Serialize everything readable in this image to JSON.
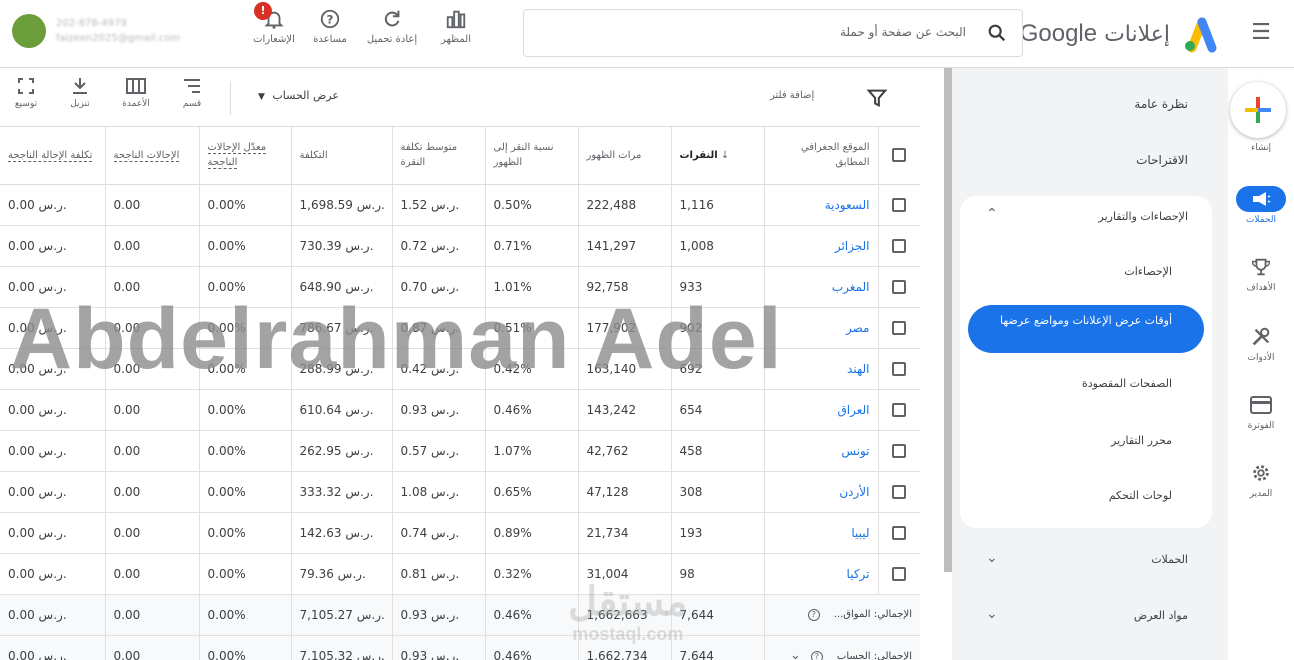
{
  "header": {
    "brand_ar": "إعلانات",
    "brand_google": "Google",
    "search_placeholder": "البحث عن صفحة أو حملة",
    "tools": {
      "appearance": "المظهر",
      "reload": "إعادة تحميل",
      "help": "مساعدة",
      "notifications": "الإشعارات"
    },
    "notifications_badge": "!",
    "account_phone": "202-878-4979",
    "account_email": "faizeen2025@gmail.com"
  },
  "rail": {
    "create": "إنشاء",
    "campaigns": "الحملات",
    "goals": "الأهداف",
    "tools": "الأدوات",
    "billing": "الفوترة",
    "admin": "المدير"
  },
  "nav": {
    "overview": "نظرة عامة",
    "recommendations": "الاقتراحات",
    "insights_reports": "الإحصاءات والتقارير",
    "insights": "الإحصاءات",
    "when_where": "أوقات عرض الإعلانات ومواضع عرضها",
    "landing_pages": "الصفحات المقصودة",
    "report_editor": "محرر التقارير",
    "dashboards": "لوحات التحكم",
    "campaigns": "الحملات",
    "assets": "مواد العرض"
  },
  "toolbar": {
    "add_filter": "إضافة فلتر",
    "view": "عرض الحساب",
    "segment": "قسم",
    "columns": "الأعمدة",
    "download": "تنزيل",
    "expand": "توسيع"
  },
  "table": {
    "headers": {
      "geo": "الموقع الجغرافي المطابق",
      "clicks": "النقرات",
      "impressions": "مرات الظهور",
      "ctr": "نسبة النقر إلى الظهور",
      "avg_cpc": "متوسط تكلفة النقرة",
      "cost": "التكلفة",
      "conv_rate": "معدّل الإحالات الناجحة",
      "conversions": "الإحالات الناجحة",
      "cost_per_conv": "تكلفة الإحالة الناجحة"
    },
    "rows": [
      {
        "geo": "السعودية",
        "clicks": "1,116",
        "impr": "222,488",
        "ctr": "0.50%",
        "cpc": "1.52 ر.س.",
        "cost": "1,698.59 ر.س.",
        "cr": "0.00%",
        "conv": "0.00",
        "cpa": "0.00 ر.س."
      },
      {
        "geo": "الجزائر",
        "clicks": "1,008",
        "impr": "141,297",
        "ctr": "0.71%",
        "cpc": "0.72 ر.س.",
        "cost": "730.39 ر.س.",
        "cr": "0.00%",
        "conv": "0.00",
        "cpa": "0.00 ر.س."
      },
      {
        "geo": "المغرب",
        "clicks": "933",
        "impr": "92,758",
        "ctr": "1.01%",
        "cpc": "0.70 ر.س.",
        "cost": "648.90 ر.س.",
        "cr": "0.00%",
        "conv": "0.00",
        "cpa": "0.00 ر.س."
      },
      {
        "geo": "مصر",
        "clicks": "902",
        "impr": "177,902",
        "ctr": "0.51%",
        "cpc": "0.87 ر.س.",
        "cost": "786.67 ر.س.",
        "cr": "0.00%",
        "conv": "0.00",
        "cpa": "0.00 ر.س."
      },
      {
        "geo": "الهند",
        "clicks": "692",
        "impr": "163,140",
        "ctr": "0.42%",
        "cpc": "0.42 ر.س.",
        "cost": "288.99 ر.س.",
        "cr": "0.00%",
        "conv": "0.00",
        "cpa": "0.00 ر.س."
      },
      {
        "geo": "العراق",
        "clicks": "654",
        "impr": "143,242",
        "ctr": "0.46%",
        "cpc": "0.93 ر.س.",
        "cost": "610.64 ر.س.",
        "cr": "0.00%",
        "conv": "0.00",
        "cpa": "0.00 ر.س."
      },
      {
        "geo": "تونس",
        "clicks": "458",
        "impr": "42,762",
        "ctr": "1.07%",
        "cpc": "0.57 ر.س.",
        "cost": "262.95 ر.س.",
        "cr": "0.00%",
        "conv": "0.00",
        "cpa": "0.00 ر.س."
      },
      {
        "geo": "الأردن",
        "clicks": "308",
        "impr": "47,128",
        "ctr": "0.65%",
        "cpc": "1.08 ر.س.",
        "cost": "333.32 ر.س.",
        "cr": "0.00%",
        "conv": "0.00",
        "cpa": "0.00 ر.س."
      },
      {
        "geo": "ليبيا",
        "clicks": "193",
        "impr": "21,734",
        "ctr": "0.89%",
        "cpc": "0.74 ر.س.",
        "cost": "142.63 ر.س.",
        "cr": "0.00%",
        "conv": "0.00",
        "cpa": "0.00 ر.س."
      },
      {
        "geo": "تركيا",
        "clicks": "98",
        "impr": "31,004",
        "ctr": "0.32%",
        "cpc": "0.81 ر.س.",
        "cost": "79.36 ر.س.",
        "cr": "0.00%",
        "conv": "0.00",
        "cpa": "0.00 ر.س."
      }
    ],
    "totals": [
      {
        "label": "الإجمالي: المواق...",
        "clicks": "7,644",
        "impr": "1,662,663",
        "ctr": "0.46%",
        "cpc": "0.93 ر.س.",
        "cost": "7,105.27 ر.س.",
        "cr": "0.00%",
        "conv": "0.00",
        "cpa": "0.00 ر.س."
      },
      {
        "label": "الإجمالي: الحساب",
        "clicks": "7,644",
        "impr": "1,662,734",
        "ctr": "0.46%",
        "cpc": "0.93 ر.س.",
        "cost": "7,105.32 ر.س.",
        "cr": "0.00%",
        "conv": "0.00",
        "cpa": "0.00 ر.س."
      }
    ]
  },
  "watermarks": {
    "main": "Abdelrahman Adel",
    "site_ar": "مستقل",
    "site_en": "mostaql.com"
  },
  "colors": {
    "accent": "#1a73e8",
    "alert": "#d93025"
  }
}
